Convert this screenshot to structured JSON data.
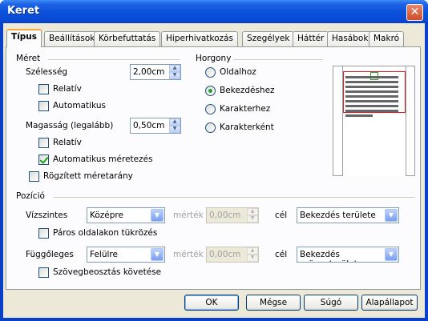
{
  "window": {
    "title": "Keret",
    "close_glyph": "✕"
  },
  "tabs": [
    {
      "label": "Típus",
      "active": true
    },
    {
      "label": "Beállítások"
    },
    {
      "label": "Körbefuttatás"
    },
    {
      "label": "Hiperhivatkozás"
    },
    {
      "label": "Szegélyek"
    },
    {
      "label": "Háttér"
    },
    {
      "label": "Hasábok"
    },
    {
      "label": "Makró"
    }
  ],
  "size": {
    "heading": "Méret",
    "width_label": "Szélesség",
    "width_value": "2,00cm",
    "relative1": "Relatív",
    "relative1_checked": false,
    "automatic1": "Automatikus",
    "automatic1_checked": false,
    "height_label": "Magasság (legalább)",
    "height_value": "0,50cm",
    "relative2": "Relatív",
    "relative2_checked": false,
    "autosize": "Automatikus méretezés",
    "autosize_checked": true,
    "keep_ratio": "Rögzített méretarány",
    "keep_ratio_checked": false
  },
  "anchor": {
    "heading": "Horgony",
    "options": [
      "Oldalhoz",
      "Bekezdéshez",
      "Karakterhez",
      "Karakterként"
    ],
    "selected": "Bekezdéshez"
  },
  "position": {
    "heading": "Pozíció",
    "horizontal_label": "Vízszintes",
    "horizontal_value": "Középre",
    "by_label": "mérték",
    "horizontal_by_value": "0,00cm",
    "to_label": "cél",
    "horizontal_to_value": "Bekezdés területe",
    "mirror": "Páros oldalakon tükrözés",
    "mirror_checked": false,
    "vertical_label": "Függőleges",
    "vertical_value": "Felülre",
    "vertical_by_value": "0,00cm",
    "vertical_to_value": "Bekezdés szövegterülete",
    "follow_flow": "Szövegbeosztás követése",
    "follow_flow_checked": false
  },
  "buttons": {
    "ok": "OK",
    "cancel": "Mégse",
    "help": "Súgó",
    "reset": "Alapállapot"
  },
  "spin_up": "▲",
  "spin_down": "▼",
  "dropdown_glyph": "▼"
}
